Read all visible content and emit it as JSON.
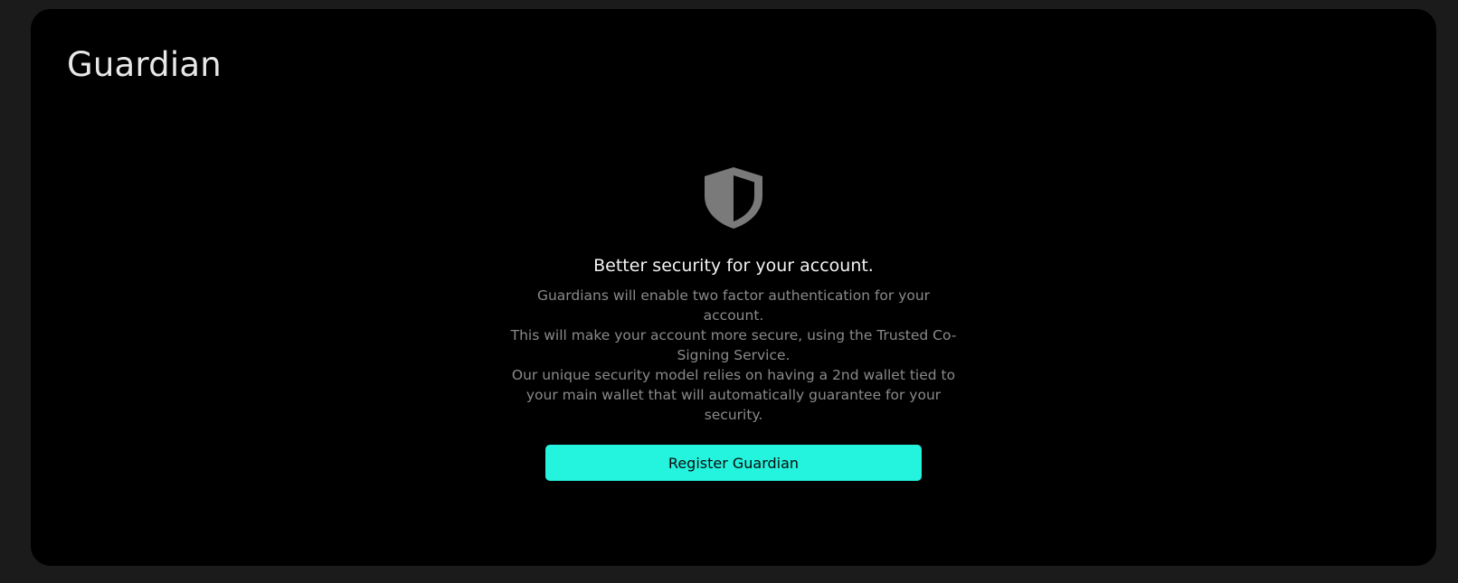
{
  "page": {
    "title": "Guardian"
  },
  "main": {
    "icon": "shield-icon",
    "heading": "Better security for your account.",
    "paragraphs": [
      "Guardians will enable two factor authentication for your account.",
      "This will make your account more secure, using the Trusted Co-Signing Service.",
      "Our unique security model relies on having a 2nd wallet tied to your main wallet that will automatically guarantee for your security."
    ],
    "button_label": "Register Guardian"
  },
  "colors": {
    "background": "#1b1b1b",
    "card": "#000000",
    "accent": "#24f3de",
    "icon": "#7a7a7a",
    "muted_text": "#8a8a8a"
  }
}
